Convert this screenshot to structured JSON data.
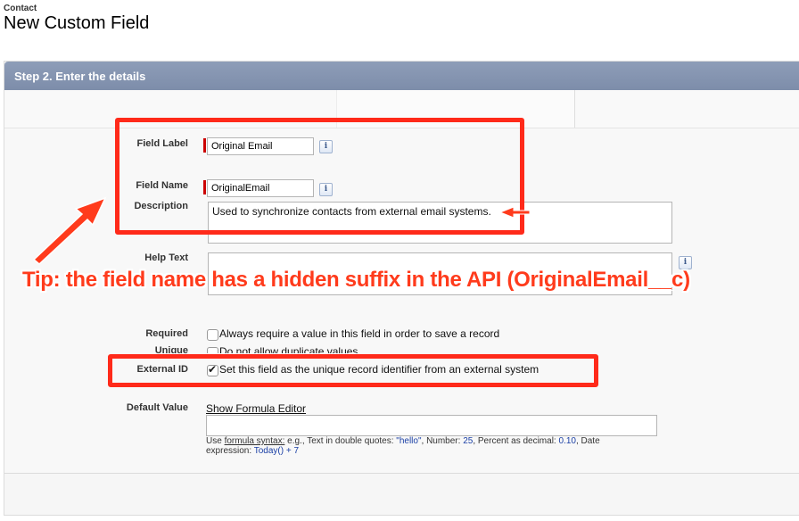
{
  "header": {
    "object_type": "Contact",
    "title": "New Custom Field"
  },
  "step": {
    "title": "Step 2. Enter the details"
  },
  "fields": {
    "field_label": {
      "label": "Field Label",
      "value": "Original Email"
    },
    "field_name": {
      "label": "Field Name",
      "value": "OriginalEmail"
    },
    "description": {
      "label": "Description",
      "value": "Used to synchronize contacts from external email systems."
    },
    "help_text": {
      "label": "Help Text",
      "value": ""
    },
    "required": {
      "label": "Required",
      "option": "Always require a value in this field in order to save a record",
      "checked": false
    },
    "unique": {
      "label": "Unique",
      "option": "Do not allow duplicate values",
      "checked": false
    },
    "external_id": {
      "label": "External ID",
      "option": "Set this field as the unique record identifier from an external system",
      "checked": true
    },
    "default_value": {
      "label": "Default Value",
      "link": "Show Formula Editor",
      "value": "",
      "hint": {
        "prefix": "Use ",
        "link": "formula syntax:",
        "part1": " e.g., Text in double quotes: ",
        "ex_text": "\"hello\"",
        "part2": ", Number: ",
        "ex_number": "25",
        "part3": ", Percent as decimal: ",
        "ex_percent": "0.10",
        "part4": ", Date expression: ",
        "ex_date": "Today() + 7"
      }
    }
  },
  "info_icon_glyph": "i",
  "annotation": {
    "tip": "Tip: the field name has a hidden suffix in the API (OriginalEmail__c)",
    "color": "#ff2a1a"
  }
}
